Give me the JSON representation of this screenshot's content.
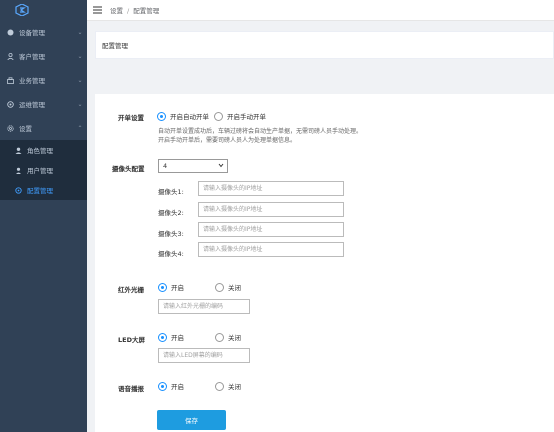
{
  "sidebar": {
    "items": [
      {
        "label": "设备管理",
        "icon": "device-icon"
      },
      {
        "label": "客户管理",
        "icon": "user-icon"
      },
      {
        "label": "业务管理",
        "icon": "business-icon"
      },
      {
        "label": "运维管理",
        "icon": "maintenance-icon"
      },
      {
        "label": "设置",
        "icon": "settings-icon"
      }
    ],
    "sub_items": [
      {
        "label": "角色管理",
        "icon": "role-icon"
      },
      {
        "label": "用户管理",
        "icon": "user-manage-icon"
      },
      {
        "label": "配置管理",
        "icon": "config-icon"
      }
    ]
  },
  "header": {
    "crumb_1": "设置",
    "crumb_sep": "/",
    "crumb_2": "配置管理"
  },
  "page_title": "配置管理",
  "form": {
    "open_label": "开单设置",
    "open_auto": "开启自动开单",
    "open_manual": "开启手动开单",
    "open_note_1": "自动开单设置成功后，车辆过磅将会自动生产单据，无需司磅人员手动处理。",
    "open_note_2": "开启手动开单后，需要司磅人员人为处理单据信息。",
    "camera_label": "摄像头配置",
    "camera_count": "4",
    "cameras": [
      {
        "label": "摄像头1:",
        "placeholder": "请输入摄像头的IP地址"
      },
      {
        "label": "摄像头2:",
        "placeholder": "请输入摄像头的IP地址"
      },
      {
        "label": "摄像头3:",
        "placeholder": "请输入摄像头的IP地址"
      },
      {
        "label": "摄像头4:",
        "placeholder": "请输入摄像头的IP地址"
      }
    ],
    "infrared_label": "红外光栅",
    "infrared_on": "开启",
    "infrared_off": "关闭",
    "infrared_placeholder": "请输入红外光栅的编码",
    "led_label": "LED大屏",
    "led_on": "开启",
    "led_off": "关闭",
    "led_placeholder": "请输入LED屏幕的编码",
    "voice_label": "语音播报",
    "voice_on": "开启",
    "voice_off": "关闭",
    "save_label": "保存"
  },
  "colors": {
    "sidebar_bg": "#304156",
    "submenu_bg": "#1f2d3d",
    "active": "#409eff",
    "button": "#1e9ce0"
  }
}
